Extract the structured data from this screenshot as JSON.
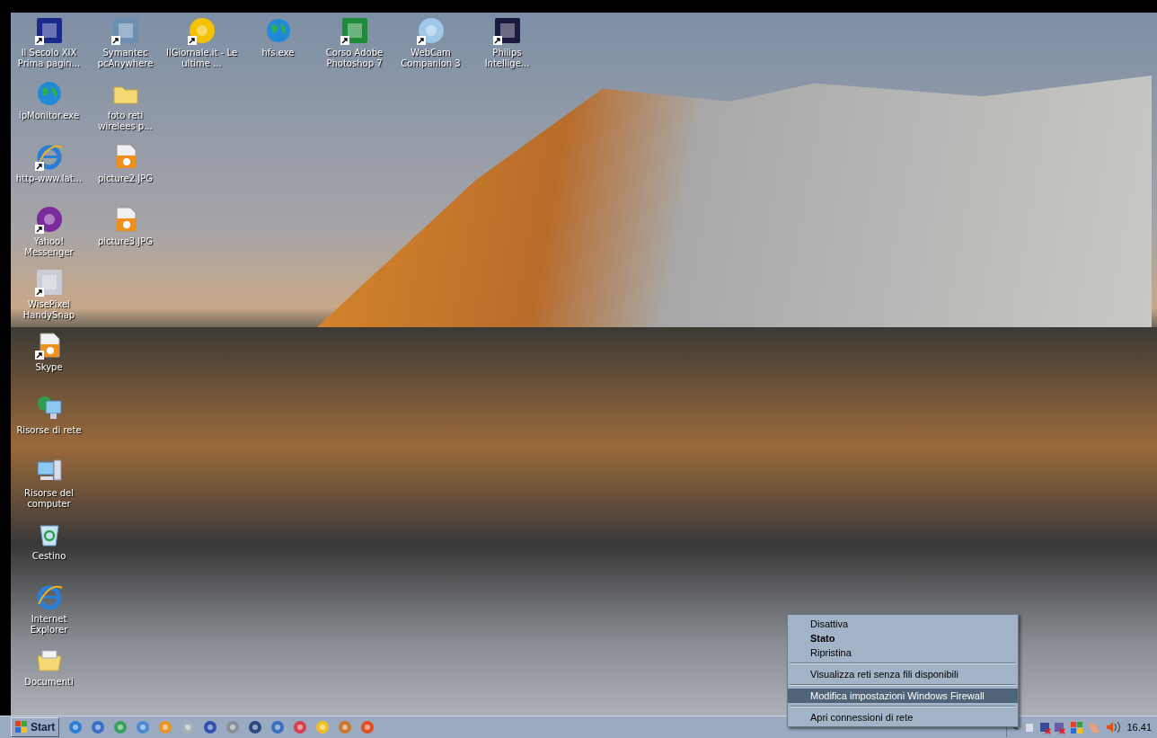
{
  "desktop": {
    "icon_rows": [
      [
        {
          "label": "Il Secolo XIX Prima pagin...",
          "kind": "tile",
          "color": "#1a2a8a",
          "shortcut": true
        },
        {
          "label": "Symantec pcAnywhere",
          "kind": "tile",
          "color": "#6b8fb0",
          "shortcut": true
        },
        {
          "label": "IlGiornale.it - Le ultime ...",
          "kind": "disc",
          "color": "#f2c200",
          "shortcut": true
        },
        {
          "label": "hfs.exe",
          "kind": "globe",
          "shortcut": false
        },
        {
          "label": "Corso Adobe Photoshop 7",
          "kind": "tile",
          "color": "#1e8a3a",
          "shortcut": true
        },
        {
          "label": "WebCam Companion 3",
          "kind": "disc",
          "color": "#9ec8e8",
          "shortcut": true
        },
        {
          "label": "Philips Intellige...",
          "kind": "tile",
          "color": "#1a1a40",
          "shortcut": true
        }
      ],
      [
        {
          "label": "ipMonitor.exe",
          "kind": "globe",
          "shortcut": false
        },
        {
          "label": "foto reti wirelees p...",
          "kind": "folder",
          "shortcut": false
        }
      ],
      [
        {
          "label": "http-www.lat...",
          "kind": "browser",
          "shortcut": true
        },
        {
          "label": "picture2.JPG",
          "kind": "image",
          "shortcut": false
        }
      ],
      [
        {
          "label": "Yahoo! Messenger",
          "kind": "disc",
          "color": "#7b2c9c",
          "shortcut": true
        },
        {
          "label": "picture3.JPG",
          "kind": "image",
          "shortcut": false
        }
      ],
      [
        {
          "label": "WisePixel HandySnap",
          "kind": "tile",
          "color": "#c8ccd4",
          "shortcut": true
        }
      ],
      [
        {
          "label": "Skype",
          "kind": "image",
          "shortcut": true
        }
      ],
      [
        {
          "label": "Risorse di rete",
          "kind": "network",
          "shortcut": false
        }
      ],
      [
        {
          "label": "Risorse del computer",
          "kind": "computer",
          "shortcut": false
        }
      ],
      [
        {
          "label": "Cestino",
          "kind": "bin",
          "shortcut": false
        }
      ],
      [
        {
          "label": "Internet Explorer",
          "kind": "browser",
          "shortcut": false
        }
      ],
      [
        {
          "label": "Documenti",
          "kind": "documents",
          "shortcut": false
        }
      ]
    ]
  },
  "context_menu": {
    "items": [
      {
        "kind": "item",
        "label": "Disattiva",
        "default": false,
        "selected": false
      },
      {
        "kind": "item",
        "label": "Stato",
        "default": true,
        "selected": false
      },
      {
        "kind": "item",
        "label": "Ripristina",
        "default": false,
        "selected": false
      },
      {
        "kind": "separator"
      },
      {
        "kind": "item",
        "label": "Visualizza reti senza fili disponibili",
        "default": false,
        "selected": false
      },
      {
        "kind": "separator"
      },
      {
        "kind": "item",
        "label": "Modifica impostazioni Windows Firewall",
        "default": false,
        "selected": true
      },
      {
        "kind": "separator"
      },
      {
        "kind": "item",
        "label": "Apri connessioni di rete",
        "default": false,
        "selected": false
      }
    ]
  },
  "taskbar": {
    "start_label": "Start",
    "quick_launch": [
      {
        "color": "#2a7fd4"
      },
      {
        "color": "#3a6fc8"
      },
      {
        "color": "#3aa060"
      },
      {
        "color": "#4a8ad0"
      },
      {
        "color": "#e8962a"
      },
      {
        "color": "#a8b0b8"
      },
      {
        "color": "#3050b0"
      },
      {
        "color": "#8a8f98"
      },
      {
        "color": "#2c4a80"
      },
      {
        "color": "#3a70c0"
      },
      {
        "color": "#d84050"
      },
      {
        "color": "#f0c020"
      },
      {
        "color": "#c87830"
      },
      {
        "color": "#e05020"
      }
    ],
    "tray_expand": "«",
    "clock": "16.41"
  }
}
